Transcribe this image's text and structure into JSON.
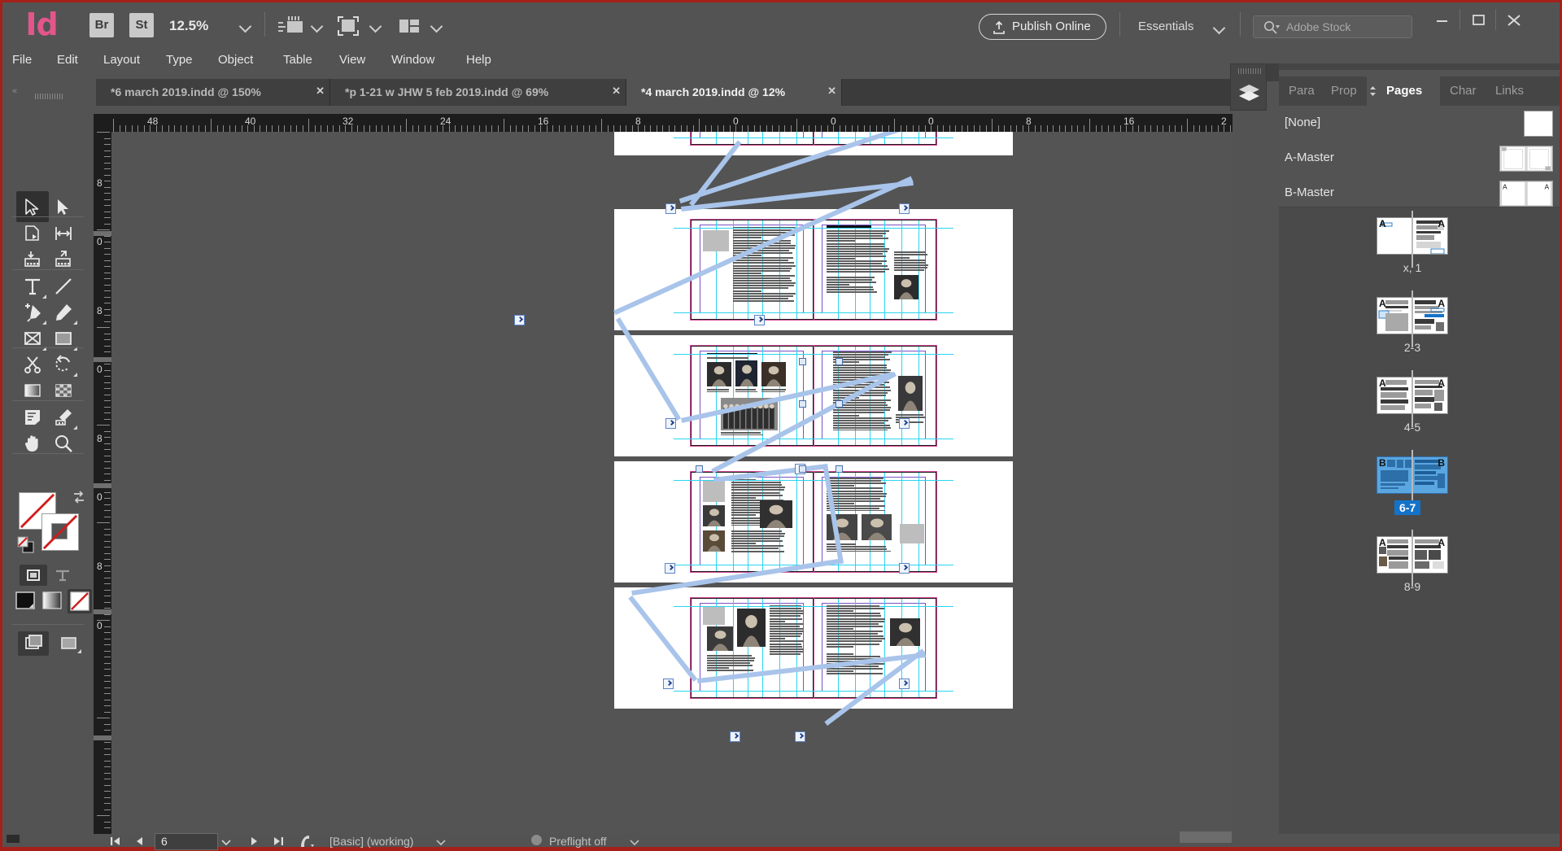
{
  "app": {
    "name": "Adobe InDesign",
    "logo_text": "Id",
    "zoom_level": "12.5%",
    "bridge_button": "Br",
    "stock_button": "St",
    "publish_online": "Publish Online",
    "workspace": "Essentials",
    "stock_search_placeholder": "Adobe Stock",
    "window_controls": {
      "minimize": "–",
      "maximize": "❑",
      "close": "✕"
    }
  },
  "menu": {
    "items": [
      {
        "label": "File"
      },
      {
        "label": "Edit"
      },
      {
        "label": "Layout"
      },
      {
        "label": "Type"
      },
      {
        "label": "Object"
      },
      {
        "label": "Table"
      },
      {
        "label": "View"
      },
      {
        "label": "Window"
      },
      {
        "label": "Help"
      }
    ]
  },
  "document_tabs": [
    {
      "label": "*6 march 2019.indd @ 150%",
      "close": "✕",
      "active": false
    },
    {
      "label": "*p 1-21 w JHW 5 feb 2019.indd @ 69%",
      "close": "✕",
      "active": false
    },
    {
      "label": "*4 march 2019.indd @ 12%",
      "close": "✕",
      "active": true
    }
  ],
  "tools": [
    {
      "name": "selection-tool",
      "selected": true
    },
    {
      "name": "direct-selection-tool",
      "selected": false
    },
    {
      "name": "page-tool",
      "selected": false
    },
    {
      "name": "gap-tool",
      "selected": false
    },
    {
      "name": "content-collector-tool",
      "selected": false
    },
    {
      "name": "content-placer-tool",
      "selected": false
    },
    {
      "name": "type-tool",
      "selected": false
    },
    {
      "name": "line-tool",
      "selected": false
    },
    {
      "name": "pen-tool",
      "selected": false
    },
    {
      "name": "pencil-tool",
      "selected": false
    },
    {
      "name": "frame-tool",
      "selected": false
    },
    {
      "name": "rectangle-tool",
      "selected": false
    },
    {
      "name": "scissors-tool",
      "selected": false
    },
    {
      "name": "free-transform-tool",
      "selected": false
    },
    {
      "name": "gradient-swatch-tool",
      "selected": false
    },
    {
      "name": "gradient-feather-tool",
      "selected": false
    },
    {
      "name": "note-tool",
      "selected": false
    },
    {
      "name": "eyedropper-tool",
      "selected": false
    },
    {
      "name": "hand-tool",
      "selected": false
    },
    {
      "name": "zoom-tool",
      "selected": false
    }
  ],
  "rulers": {
    "horizontal_labels": [
      "48",
      "40",
      "32",
      "24",
      "16",
      "8",
      "0",
      "0",
      "0",
      "8",
      "16",
      "2"
    ],
    "vertical_labels": [
      "8",
      "0",
      "8",
      "0",
      "8",
      "0",
      "8",
      "0"
    ],
    "units": "picas"
  },
  "panel": {
    "tabs": [
      {
        "label": "Para",
        "active": false
      },
      {
        "label": "Prop",
        "active": false
      },
      {
        "label": "Pages",
        "active": true
      },
      {
        "label": "Char",
        "active": false
      },
      {
        "label": "Links",
        "active": false
      }
    ],
    "masters": [
      {
        "label": "[None]",
        "thumb": "blank"
      },
      {
        "label": "A-Master",
        "thumb": "a"
      },
      {
        "label": "B-Master",
        "thumb": "b",
        "letters": [
          "A",
          "A"
        ]
      }
    ],
    "spreads": [
      {
        "label": "x, 1",
        "masters": [
          "A",
          "A"
        ],
        "selected": false,
        "style": "one"
      },
      {
        "label": "2-3",
        "masters": [
          "A",
          "A"
        ],
        "selected": false,
        "style": "two"
      },
      {
        "label": "4-5",
        "masters": [
          "A",
          "A"
        ],
        "selected": false,
        "style": "three"
      },
      {
        "label": "6-7",
        "masters": [
          "B",
          "B"
        ],
        "selected": true,
        "style": "four"
      },
      {
        "label": "8-9",
        "masters": [
          "A",
          "A"
        ],
        "selected": false,
        "style": "five"
      }
    ],
    "collapse_icon": "»",
    "layers_icon": "layers-icon"
  },
  "status_bar": {
    "first_page_icon": "⏮",
    "prev_page_icon": "◀",
    "current_page": "6",
    "next_page_icon": "▶",
    "last_page_icon": "⏭",
    "style_label": "[Basic] (working)",
    "preflight_label": "Preflight off"
  },
  "colors": {
    "accent_pink": "#e2568b",
    "chrome_bg": "#535353",
    "panel_bg": "#454545",
    "selection_blue": "#1473c8",
    "guide_cyan": "#2ad4f0",
    "bleed_magenta": "#d64b9a",
    "margin_purple": "#7b52c4",
    "thread_blue": "#a9c4ea",
    "red_border": "#a52019"
  },
  "canvas": {
    "view_zoom": "12.5%",
    "spreads_visible": 5,
    "description": "Five facing-page spreads shown vertically in story-thread view with text-frame threading arrows"
  }
}
